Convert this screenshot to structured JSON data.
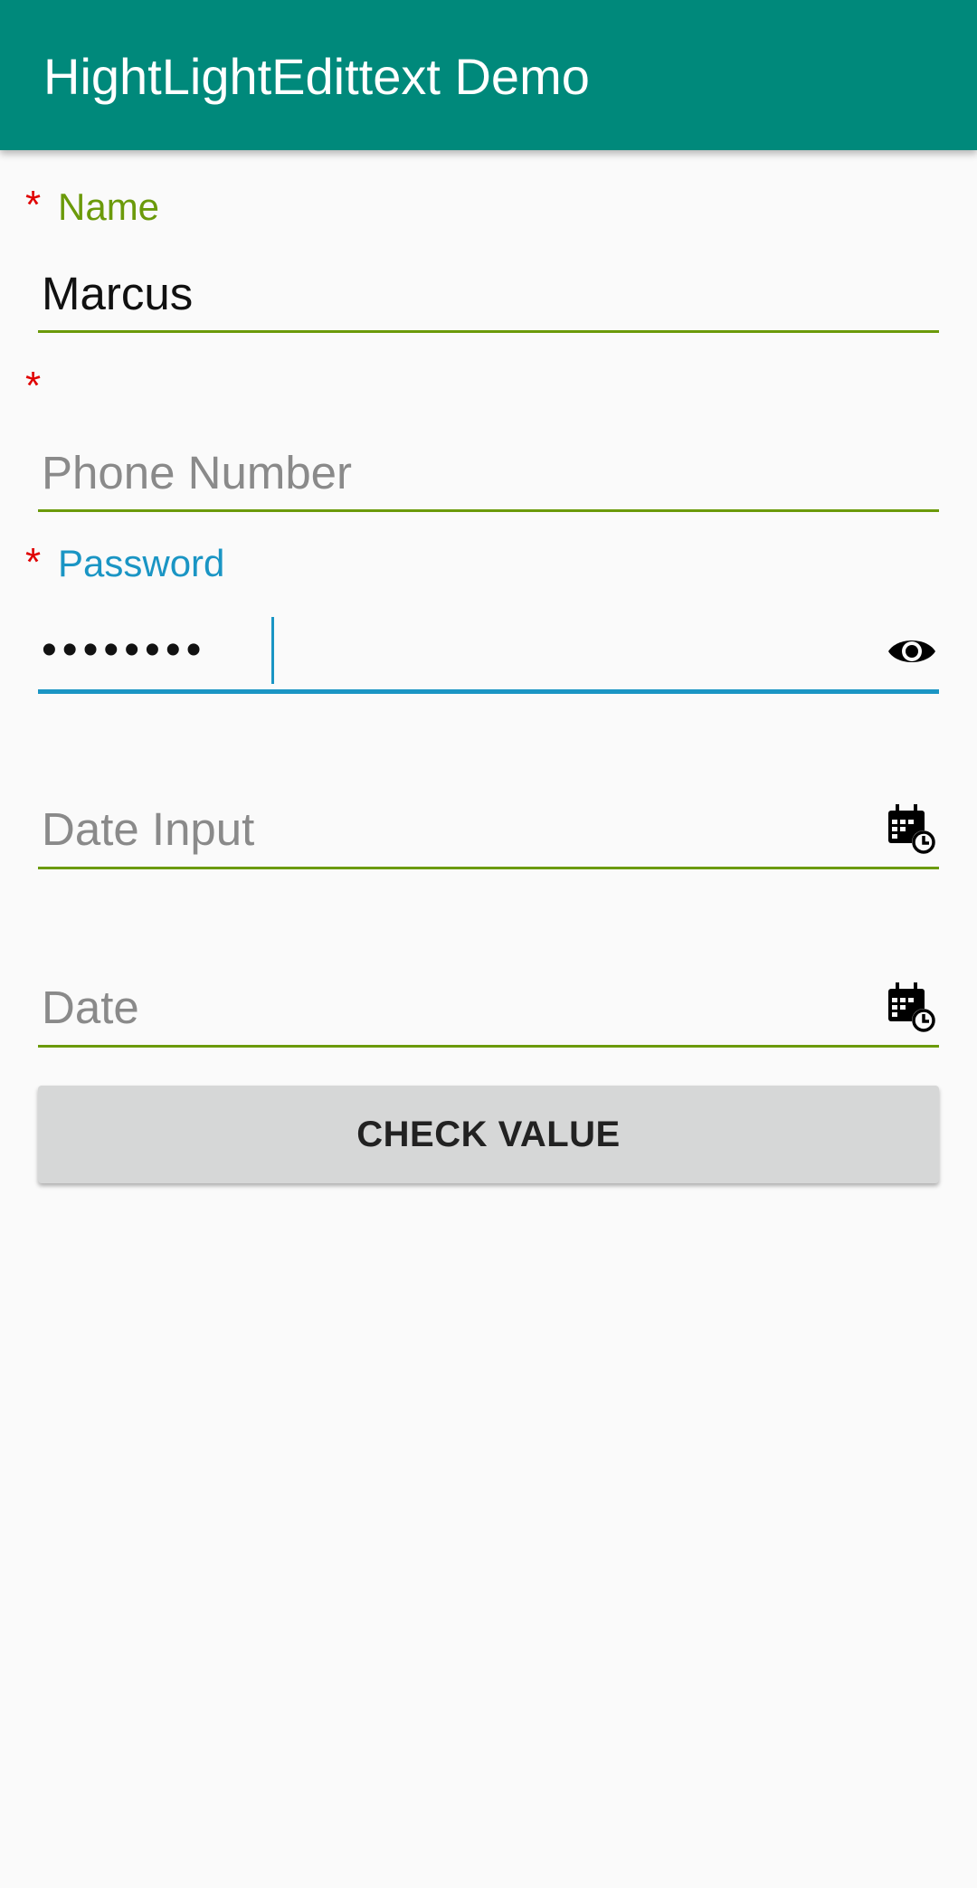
{
  "app_bar": {
    "title": "HightLightEdittext Demo",
    "background_color": "#00897b"
  },
  "form": {
    "required_marker": "*",
    "name_field": {
      "label": "Name",
      "value": "Marcus",
      "accent_color": "#6b9a0a"
    },
    "phone_field": {
      "label": "",
      "placeholder": "Phone Number",
      "accent_color": "#6b9a0a"
    },
    "password_field": {
      "label": "Password",
      "masked_value": "••••••••",
      "accent_color": "#1a95c4",
      "trailing_icon": "eye-icon",
      "focused": true
    },
    "date_input_field": {
      "placeholder": "Date Input",
      "trailing_icon": "calendar-clock-icon"
    },
    "date_field": {
      "placeholder": "Date",
      "trailing_icon": "calendar-clock-icon"
    },
    "check_button": {
      "label": "CHECK VALUE"
    }
  }
}
